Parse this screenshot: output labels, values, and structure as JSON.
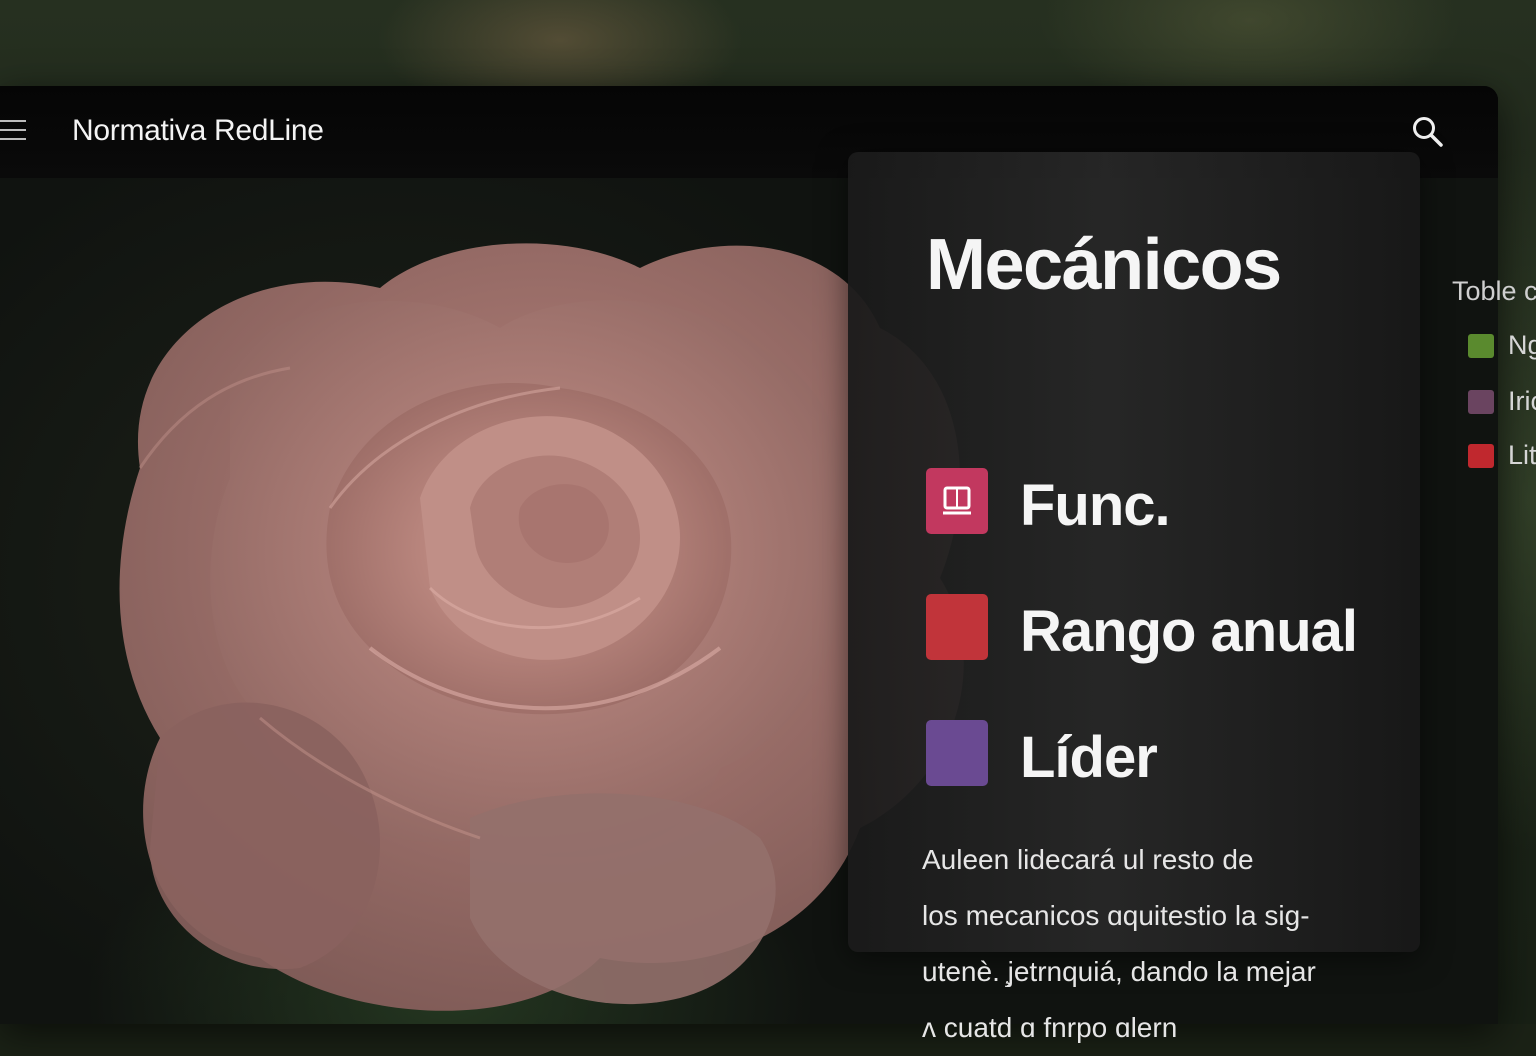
{
  "app": {
    "title": "Normativa RedLine"
  },
  "panel": {
    "title": "Mecánicos",
    "legend": [
      {
        "label": "Func.",
        "color": "#c2385f",
        "icon": "book-icon"
      },
      {
        "label": "Rango anual",
        "color": "#c1343a"
      },
      {
        "label": "Líder",
        "color": "#6a4a92"
      }
    ],
    "body_lines": [
      "Auleen lidecará ul resto de",
      "los mecanicos ɑquitestio la sig-",
      "utenè. ̧jetrnquiá, dando la mejar",
      "ʌ cuatd ɑ fnrpo ɑlern"
    ]
  },
  "side_legend": {
    "title": "Toble c",
    "items": [
      {
        "label": "Ng",
        "color": "#5a8a2e"
      },
      {
        "label": "Iric",
        "color": "#6a4460"
      },
      {
        "label": "Lit",
        "color": "#c0282e"
      }
    ]
  }
}
